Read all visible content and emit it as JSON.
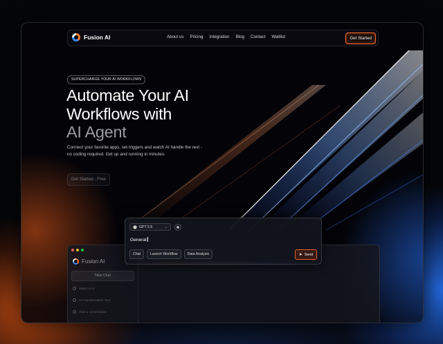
{
  "nav": {
    "brand": "Fusion AI",
    "links": [
      "About us",
      "Pricing",
      "Integration",
      "Blog",
      "Contact",
      "Waitlist"
    ],
    "cta": "Get Started"
  },
  "hero": {
    "badge": "SUPERCHARGE YOUR AI WORKFLOWS",
    "title_line1": "Automate Your AI",
    "title_line2": "Workflows with",
    "title_line3": "AI Agent",
    "subtitle": "Connect your favorite apps, set triggers and watch AI handle the rest - no coding required. Get up and running in minutes.",
    "cta": "Get Started - Free"
  },
  "chat": {
    "model": "GPT 5.5",
    "prompt_value": "Generat",
    "chips": [
      "Chat",
      "Launch Workflow",
      "Data Analysis"
    ],
    "send": "Send"
  },
  "app": {
    "brand": "Fusion AI",
    "new_chat": "New Chat",
    "history": [
      "Select AI AI",
      "AI Transformation Tool",
      "Start a conversation"
    ]
  },
  "colors": {
    "accent_orange": "#ff6a2a",
    "accent_blue": "#3a8cff",
    "background": "#050608"
  },
  "icons": {
    "brand": "fusion-logo-icon",
    "model": "model-icon",
    "attach": "attach-icon",
    "send": "send-icon",
    "history": "chat-bubble-icon"
  }
}
